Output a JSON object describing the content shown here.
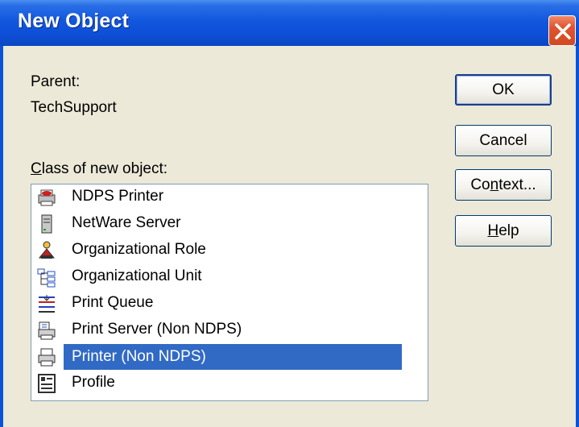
{
  "window": {
    "title": "New Object"
  },
  "parent": {
    "label": "Parent:",
    "value": "TechSupport"
  },
  "class_label": "Class of new object:",
  "class_label_accel": "C",
  "class_label_rest": "lass of new object:",
  "buttons": {
    "ok": "OK",
    "cancel": "Cancel",
    "context_accel": "Co",
    "context_under": "n",
    "context_rest": "text...",
    "help_under": "H",
    "help_rest": "elp"
  },
  "items": [
    {
      "label": "NDPS Printer",
      "icon": "ndps-printer-icon"
    },
    {
      "label": "NetWare Server",
      "icon": "server-icon"
    },
    {
      "label": "Organizational Role",
      "icon": "organizational-role-icon"
    },
    {
      "label": "Organizational Unit",
      "icon": "organizational-unit-icon"
    },
    {
      "label": "Print Queue",
      "icon": "print-queue-icon"
    },
    {
      "label": "Print Server (Non NDPS)",
      "icon": "print-server-icon"
    },
    {
      "label": "Printer (Non NDPS)",
      "icon": "printer-icon",
      "selected": true
    },
    {
      "label": "Profile",
      "icon": "profile-icon"
    }
  ],
  "colors": {
    "titlebar": "#0d4fd6",
    "client": "#ece9d8",
    "selection": "#316ac5",
    "close": "#d24a20"
  }
}
